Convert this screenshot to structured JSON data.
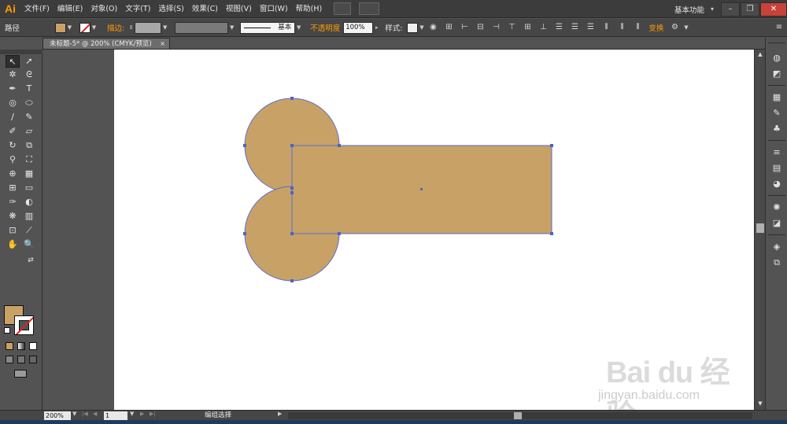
{
  "app": {
    "logo": "Ai",
    "menus": [
      "文件(F)",
      "编辑(E)",
      "对象(O)",
      "文字(T)",
      "选择(S)",
      "效果(C)",
      "视图(V)",
      "窗口(W)",
      "帮助(H)"
    ],
    "workspace": "基本功能"
  },
  "controlbar": {
    "selection_type": "路径",
    "stroke_label": "描边:",
    "stroke_profile": "基本",
    "opacity_label": "不透明度",
    "opacity_value": "100%",
    "style_label": "样式:",
    "transform_label": "变换"
  },
  "document": {
    "tab_title": "未标题-5* @ 200% (CMYK/预览)",
    "close_symbol": "×"
  },
  "statusbar": {
    "zoom": "200%",
    "page": "1",
    "tool_status": "编组选择"
  },
  "watermark": {
    "logo": "Bai du 经验",
    "url": "jingyan.baidu.com"
  },
  "colors": {
    "fill": "#c8a167",
    "selection": "#4a64c8",
    "accent": "#ff9a00"
  }
}
